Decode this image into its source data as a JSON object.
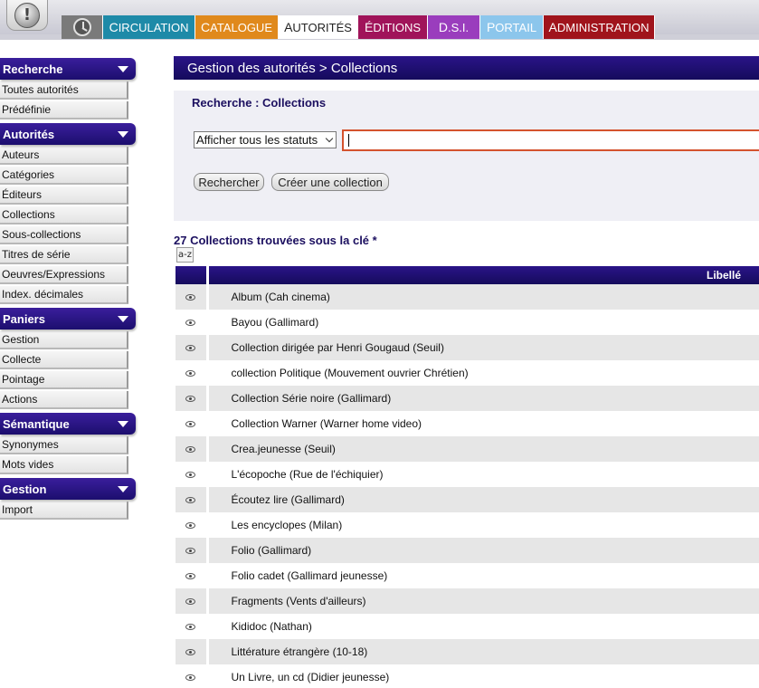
{
  "topbar": {
    "tabs": [
      {
        "label": "Circulation",
        "cap": "C",
        "rest": "IRCULATION"
      },
      {
        "label": "Catalogue",
        "cap": "C",
        "rest": "ATALOGUE"
      },
      {
        "label": "Autorités",
        "cap": "A",
        "rest": "UTORITÉS"
      },
      {
        "label": "Éditions",
        "cap": "É",
        "rest": "DITIONS"
      },
      {
        "label": "D.S.I.",
        "cap": "D",
        "rest": ".S.I."
      },
      {
        "label": "Portail",
        "cap": "P",
        "rest": "ORTAIL"
      },
      {
        "label": "Administration",
        "cap": "A",
        "rest": "DMINISTRATION"
      }
    ],
    "colors": {
      "circulation": "#1e8aa8",
      "catalogue": "#e0891c",
      "autorites": "#ffffff",
      "editions": "#a0145a",
      "dsi": "#9a3dbd",
      "portail": "#8cc6ec",
      "administration": "#a0141c"
    }
  },
  "sidebar": {
    "sections": [
      {
        "title": "Recherche",
        "items": [
          "Toutes autorités",
          "Prédéfinie"
        ]
      },
      {
        "title": "Autorités",
        "items": [
          "Auteurs",
          "Catégories",
          "Éditeurs",
          "Collections",
          "Sous-collections",
          "Titres de série",
          "Oeuvres/Expressions",
          "Index. décimales"
        ]
      },
      {
        "title": "Paniers",
        "items": [
          "Gestion",
          "Collecte",
          "Pointage",
          "Actions"
        ]
      },
      {
        "title": "Sémantique",
        "items": [
          "Synonymes",
          "Mots vides"
        ]
      },
      {
        "title": "Gestion",
        "items": [
          "Import"
        ]
      }
    ]
  },
  "main": {
    "page_title": "Gestion des autorités > Collections",
    "search": {
      "title": "Recherche : Collections",
      "status_select_value": "Afficher tous les statuts",
      "input_value": "",
      "search_button": "Rechercher",
      "create_button": "Créer une collection"
    },
    "results": {
      "title": "27 Collections trouvées sous la clé *",
      "sort_label": "a-z",
      "column_header": "Libellé",
      "rows": [
        "Album (Cah cinema)",
        "Bayou (Gallimard)",
        "Collection dirigée par Henri Gougaud (Seuil)",
        "collection Politique (Mouvement ouvrier Chrétien)",
        "Collection Série noire (Gallimard)",
        "Collection Warner (Warner home video)",
        "Crea.jeunesse (Seuil)",
        "L'écopoche (Rue de l'échiquier)",
        "Écoutez lire (Gallimard)",
        "Les encyclopes (Milan)",
        "Folio (Gallimard)",
        "Folio cadet (Gallimard jeunesse)",
        "Fragments (Vents d'ailleurs)",
        "Kididoc (Nathan)",
        "Littérature étrangère (10-18)",
        "Un Livre, un cd (Didier jeunesse)"
      ]
    }
  }
}
